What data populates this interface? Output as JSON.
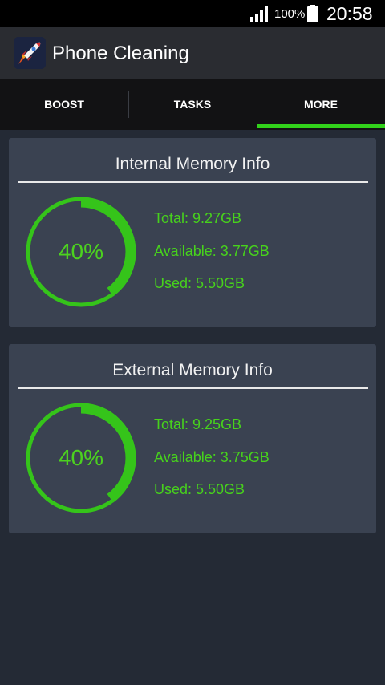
{
  "status_bar": {
    "battery": "100%",
    "time": "20:58"
  },
  "app_bar": {
    "title": "Phone Cleaning",
    "logo_icon": "rocket-icon"
  },
  "tabs": [
    {
      "label": "BOOST",
      "selected": false
    },
    {
      "label": "TASKS",
      "selected": false
    },
    {
      "label": "MORE",
      "selected": true
    }
  ],
  "internal": {
    "title": "Internal Memory Info",
    "percent_text": "40%",
    "used_fraction": 0.4,
    "total": "Total: 9.27GB",
    "available": "Available: 3.77GB",
    "used": "Used: 5.50GB"
  },
  "external": {
    "title": "External Memory Info",
    "percent_text": "40%",
    "used_fraction": 0.4,
    "total": "Total: 9.25GB",
    "available": "Available: 3.75GB",
    "used": "Used: 5.50GB"
  },
  "colors": {
    "accent": "#32d21b",
    "card": "#3a4251",
    "background": "#242a35"
  }
}
